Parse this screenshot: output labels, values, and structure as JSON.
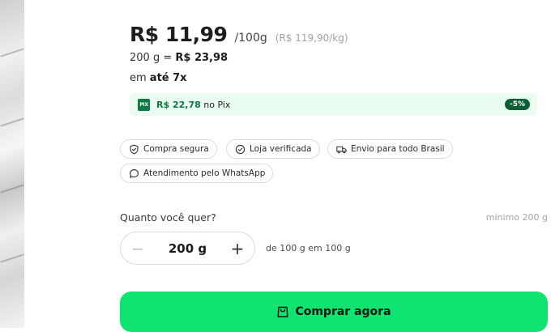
{
  "price": {
    "main": "R$ 11,99",
    "unit": "/100g",
    "reference": "(R$ 119,90/kg)"
  },
  "total": {
    "prefix": "200 g = ",
    "value": "R$ 23,98"
  },
  "installments": {
    "prefix": "em ",
    "value": "até 7x"
  },
  "pix": {
    "icon_text": "PIX",
    "price": "R$ 22,78",
    "suffix": " no Pix",
    "discount": "-5%"
  },
  "badges": [
    {
      "label": "Compra segura",
      "icon": "shield-check-icon"
    },
    {
      "label": "Loja verificada",
      "icon": "check-circle-icon"
    },
    {
      "label": "Envio para todo Brasil",
      "icon": "truck-icon"
    },
    {
      "label": "Atendimento pelo WhatsApp",
      "icon": "chat-bubble-icon"
    }
  ],
  "quantity": {
    "label": "Quanto você quer?",
    "minimum": "mínimo 200 g",
    "value": "200 g",
    "minus": "−",
    "plus": "+",
    "hint": "de 100 g em 100 g"
  },
  "buy_button": {
    "label": "Comprar agora",
    "icon": "shopping-bag-icon"
  },
  "colors": {
    "accent": "#0ee46f",
    "pix_green": "#0b7a43",
    "pix_bg": "#eafbf0"
  }
}
